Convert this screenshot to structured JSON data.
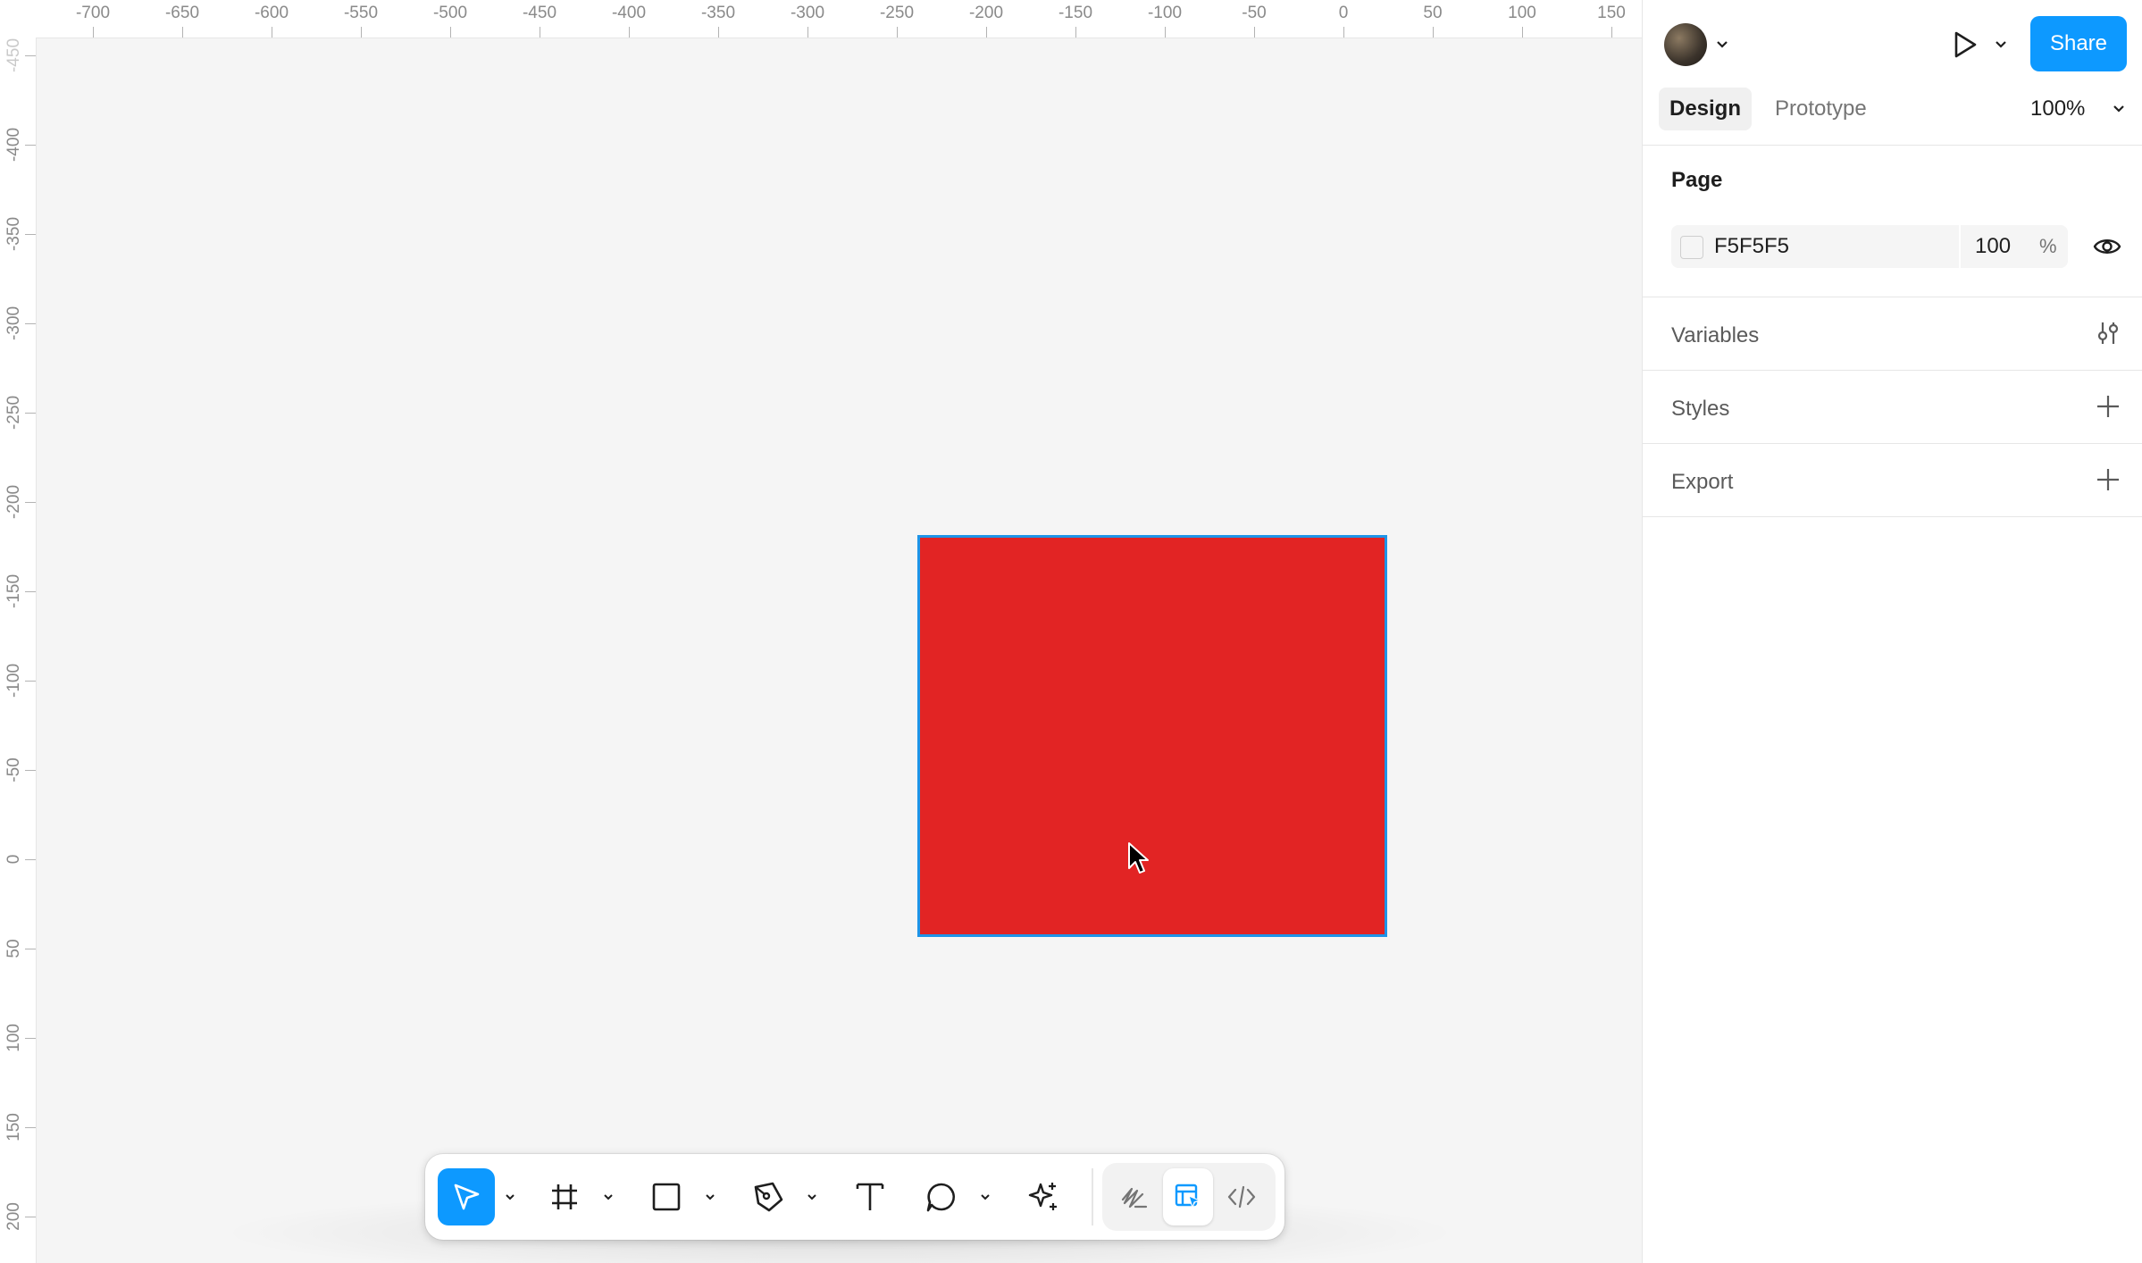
{
  "rulers": {
    "horizontal": [
      "-700",
      "-650",
      "-600",
      "-550",
      "-500",
      "-450",
      "-400",
      "-350",
      "-300",
      "-250",
      "-200",
      "-150",
      "-100",
      "-50",
      "0",
      "50",
      "100",
      "150"
    ],
    "vertical": [
      "-450",
      "-400",
      "-350",
      "-300",
      "-250",
      "-200",
      "-150",
      "-100",
      "-50",
      "0",
      "50",
      "100",
      "150",
      "200"
    ]
  },
  "canvas": {
    "background": "#f5f5f5",
    "rectangle_fill": "#e22424",
    "selection_color": "#1e94e8"
  },
  "toolbar": {
    "tools": [
      {
        "name": "move-tool",
        "icon": "cursor-arrow-icon",
        "active": true
      },
      {
        "name": "frame-tool",
        "icon": "hash-frame-icon"
      },
      {
        "name": "shape-tool",
        "icon": "square-icon"
      },
      {
        "name": "pen-tool",
        "icon": "pen-icon"
      },
      {
        "name": "text-tool",
        "icon": "text-t-icon"
      },
      {
        "name": "comment-tool",
        "icon": "comment-bubble-icon"
      },
      {
        "name": "actions-tool",
        "icon": "sparkle-icon"
      }
    ],
    "modes": [
      {
        "name": "draw-mode",
        "icon": "draw-squiggle-icon"
      },
      {
        "name": "design-mode",
        "icon": "design-mode-icon",
        "active": true
      },
      {
        "name": "dev-mode",
        "icon": "code-brackets-icon"
      }
    ]
  },
  "panel": {
    "share_label": "Share",
    "tabs": {
      "design": "Design",
      "prototype": "Prototype"
    },
    "zoom": "100%",
    "page": {
      "title": "Page",
      "color_hex": "F5F5F5",
      "opacity": "100",
      "opacity_unit": "%"
    },
    "sections": {
      "variables": "Variables",
      "styles": "Styles",
      "export": "Export"
    },
    "accent": "#0d99ff"
  }
}
